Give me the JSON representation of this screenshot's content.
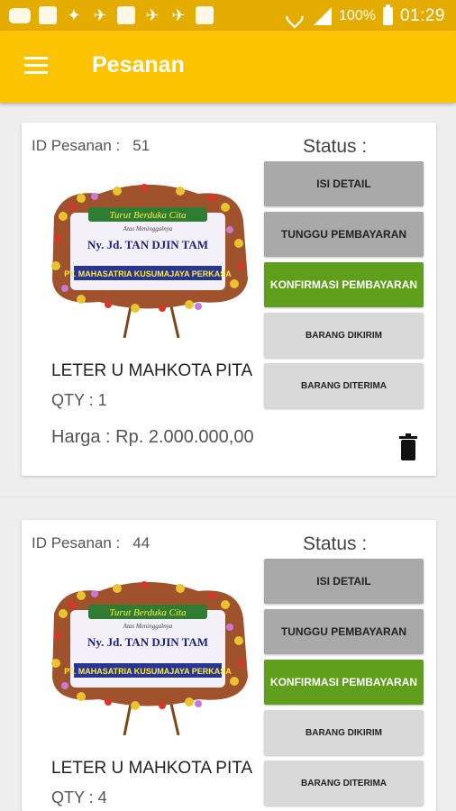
{
  "status_bar": {
    "battery": "100%",
    "time": "01:29",
    "icons": [
      "message-icon",
      "facebook-icon",
      "bird-icon",
      "bird-icon",
      "facebook-icon",
      "bird-icon",
      "bird-icon",
      "facebook-icon",
      "wifi-icon",
      "signal-icon",
      "battery-icon"
    ]
  },
  "appbar": {
    "title": "Pesanan"
  },
  "orders": [
    {
      "id_label": "ID Pesanan :",
      "id": "51",
      "status_label": "Status :",
      "banner_line1": "Turut Berduka Cita",
      "banner_line2": "Atas Meninggalnya",
      "banner_line3": "Ny. Jd. TAN DJIN TAM",
      "banner_line4": "PT. MAHASATRIA KUSUMAJAYA PERKASA",
      "name": "LETER U MAHKOTA PITA",
      "qty": "QTY :  1",
      "price": "Harga : Rp. 2.000.000,00",
      "buttons": [
        "ISI DETAIL",
        "TUNGGU PEMBAYARAN",
        "KONFIRMASI PEMBAYARAN",
        "BARANG DIKIRIM",
        "BARANG DITERIMA"
      ]
    },
    {
      "id_label": "ID Pesanan :",
      "id": "44",
      "status_label": "Status :",
      "banner_line1": "Turut Berduka Cita",
      "banner_line2": "Atas Meninggalnya",
      "banner_line3": "Ny. Jd. TAN DJIN TAM",
      "banner_line4": "PT. MAHASATRIA KUSUMAJAYA PERKASA",
      "name": "LETER U MAHKOTA PITA",
      "qty": "QTY :  4",
      "buttons": [
        "ISI DETAIL",
        "TUNGGU PEMBAYARAN",
        "KONFIRMASI PEMBAYARAN",
        "BARANG DIKIRIM",
        "BARANG DITERIMA"
      ]
    }
  ],
  "colors": {
    "status_bar": "#e5ac00",
    "app_bar": "#fcc300",
    "button_dark": "#a9a9a9",
    "button_green": "#5f9f1c",
    "button_light": "#d8d8d8"
  }
}
